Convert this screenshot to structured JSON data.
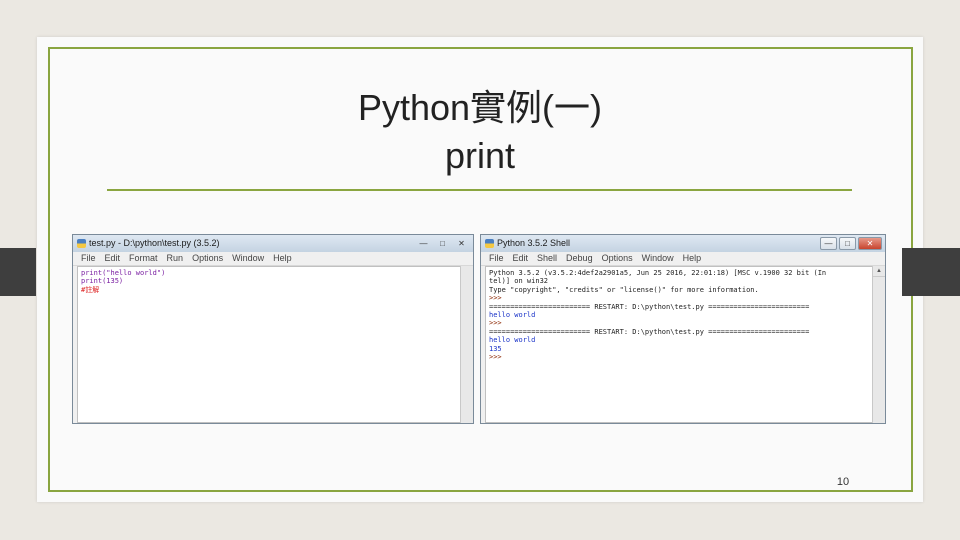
{
  "slide": {
    "title_line1": "Python實例(一)",
    "title_line2": "print",
    "page_number": "10"
  },
  "editor": {
    "title": "test.py - D:\\python\\test.py (3.5.2)",
    "menu": [
      "File",
      "Edit",
      "Format",
      "Run",
      "Options",
      "Window",
      "Help"
    ],
    "lines": [
      "print(\"hello world\")",
      "print(135)",
      "#註解"
    ]
  },
  "shell": {
    "title": "Python 3.5.2 Shell",
    "menu": [
      "File",
      "Edit",
      "Shell",
      "Debug",
      "Options",
      "Window",
      "Help"
    ],
    "lines": [
      "Python 3.5.2 (v3.5.2:4def2a2901a5, Jun 25 2016, 22:01:18) [MSC v.1900 32 bit (In",
      "tel)] on win32",
      "Type \"copyright\", \"credits\" or \"license()\" for more information.",
      ">>> ",
      "======================== RESTART: D:\\python\\test.py ========================",
      "hello world",
      ">>> ",
      "======================== RESTART: D:\\python\\test.py ========================",
      "hello world",
      "135",
      ">>> "
    ]
  },
  "colors": {
    "accent": "#8aa540",
    "side_tab": "#3e3e3e"
  }
}
